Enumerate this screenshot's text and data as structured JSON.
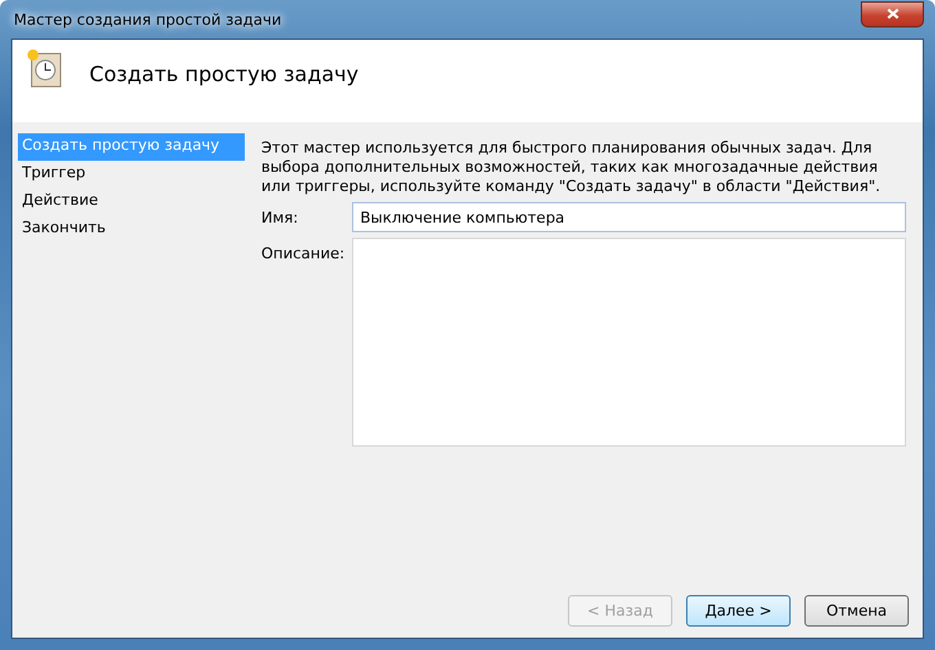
{
  "window": {
    "title": "Мастер создания простой задачи"
  },
  "header": {
    "title": "Создать простую задачу"
  },
  "steps": [
    {
      "label": "Создать простую задачу",
      "selected": true
    },
    {
      "label": "Триггер",
      "selected": false
    },
    {
      "label": "Действие",
      "selected": false
    },
    {
      "label": "Закончить",
      "selected": false
    }
  ],
  "description": "Этот мастер используется для быстрого планирования обычных задач.  Для выбора дополнительных возможностей, таких как многозадачные действия или триггеры, используйте команду \"Создать задачу\" в области \"Действия\".",
  "fields": [
    {
      "kind": "line",
      "label": "Имя:",
      "value": "Выключение компьютера"
    },
    {
      "kind": "area",
      "label": "Описание:"
    }
  ],
  "buttons": [
    {
      "label": "< Назад",
      "disabled": true,
      "default": false
    },
    {
      "label": "Далее >",
      "disabled": false,
      "default": true
    },
    {
      "label": "Отмена",
      "disabled": false,
      "default": false
    }
  ]
}
